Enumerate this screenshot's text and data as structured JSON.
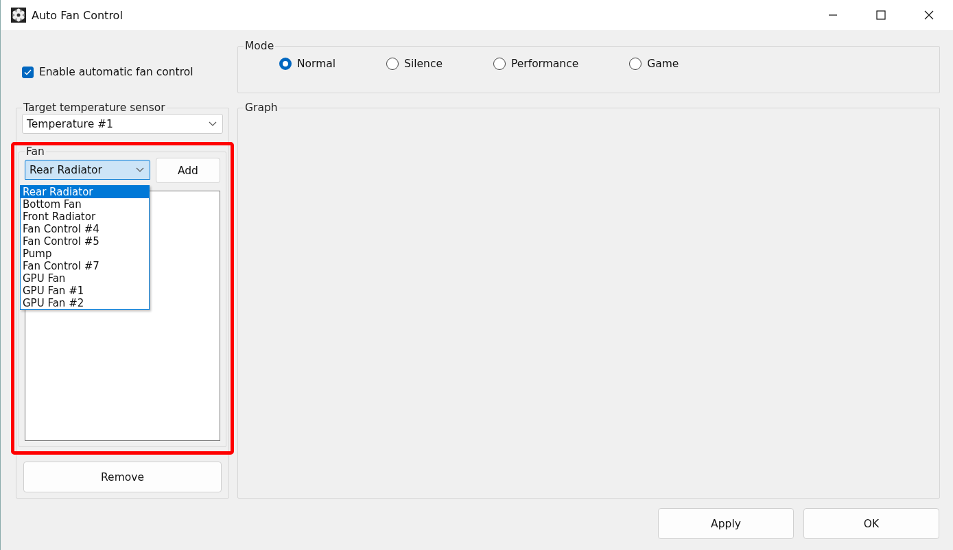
{
  "window": {
    "title": "Auto Fan Control"
  },
  "auto_control": {
    "label": "Enable automatic fan control",
    "checked": true
  },
  "mode": {
    "title": "Mode",
    "options": [
      {
        "label": "Normal",
        "selected": true
      },
      {
        "label": "Silence",
        "selected": false
      },
      {
        "label": "Performance",
        "selected": false
      },
      {
        "label": "Game",
        "selected": false
      }
    ]
  },
  "sensor": {
    "title": "Target temperature sensor",
    "value": "Temperature #1"
  },
  "fan": {
    "title": "Fan",
    "highlighted": true,
    "value": "Rear Radiator",
    "expanded": true,
    "add_button": "Add",
    "remove_button": "Remove",
    "options": [
      {
        "label": "Rear Radiator",
        "selected": true
      },
      {
        "label": "Bottom Fan",
        "selected": false
      },
      {
        "label": "Front Radiator",
        "selected": false
      },
      {
        "label": "Fan Control #4",
        "selected": false
      },
      {
        "label": "Fan Control #5",
        "selected": false
      },
      {
        "label": "Pump",
        "selected": false
      },
      {
        "label": "Fan Control #7",
        "selected": false
      },
      {
        "label": "GPU Fan",
        "selected": false
      },
      {
        "label": "GPU Fan #1",
        "selected": false
      },
      {
        "label": "GPU Fan #2",
        "selected": false
      }
    ]
  },
  "graph": {
    "title": "Graph"
  },
  "buttons": [
    "Apply",
    "OK"
  ]
}
